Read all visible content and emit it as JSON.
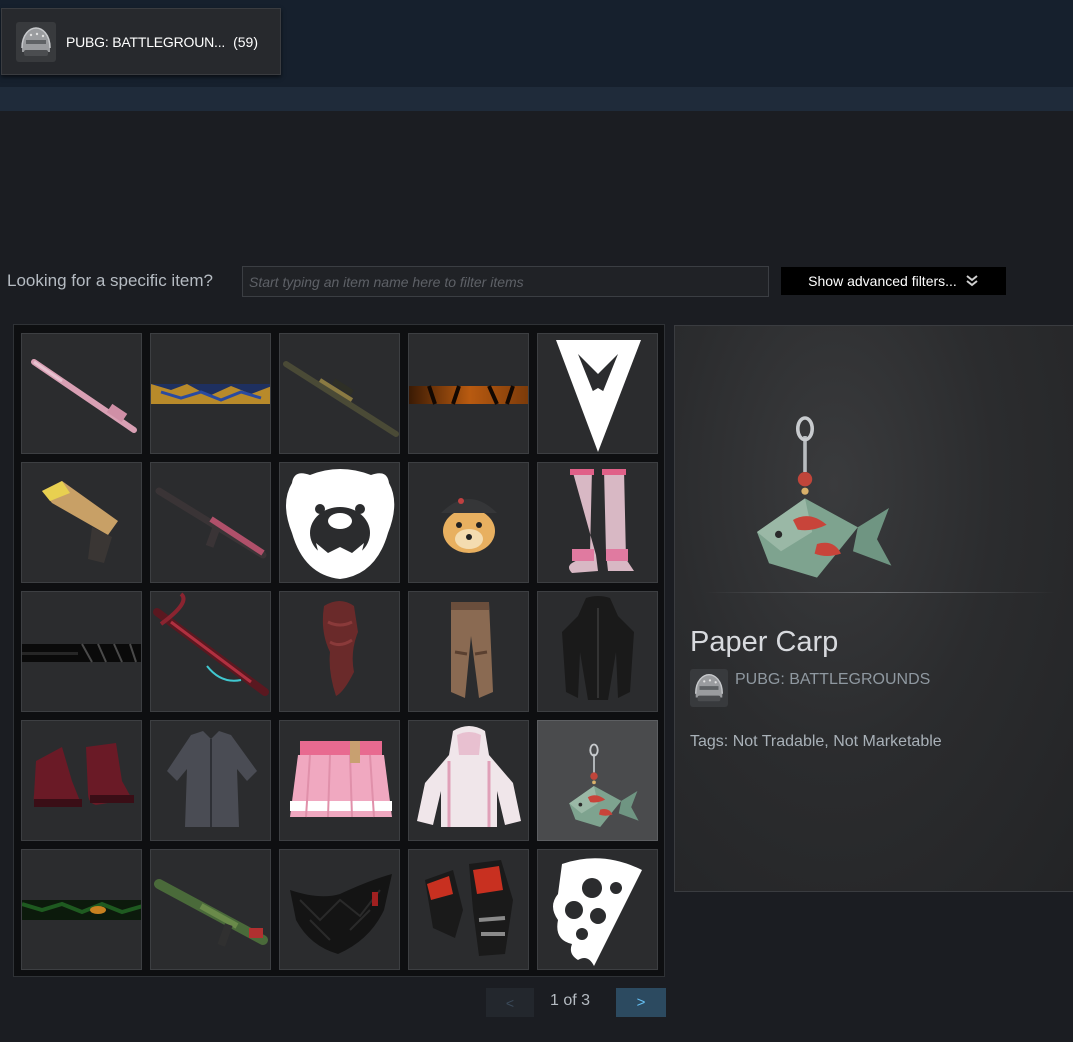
{
  "game_tab": {
    "name": "PUBG: BATTLEGROUN...",
    "count": "(59)",
    "icon": "helmet-icon"
  },
  "filter": {
    "label": "Looking for a specific item?",
    "placeholder": "Start typing an item name here to filter items",
    "advanced_label": "Show advanced filters..."
  },
  "items": [
    {
      "name": "pink-rifle",
      "icon": "rifle-icon"
    },
    {
      "name": "blue-gold-banner",
      "icon": "banner-icon"
    },
    {
      "name": "camo-sniper",
      "icon": "sniper-icon"
    },
    {
      "name": "tiger-banner",
      "icon": "banner-icon"
    },
    {
      "name": "arrow-emblem",
      "icon": "emblem-icon"
    },
    {
      "name": "desert-eagle",
      "icon": "pistol-icon"
    },
    {
      "name": "pink-assault-rifle",
      "icon": "rifle-icon"
    },
    {
      "name": "bear-emblem",
      "icon": "bear-icon"
    },
    {
      "name": "doge-emote",
      "icon": "dog-icon"
    },
    {
      "name": "pink-stockings",
      "icon": "legwear-icon"
    },
    {
      "name": "dark-banner",
      "icon": "banner-icon"
    },
    {
      "name": "crossbow",
      "icon": "crossbow-icon"
    },
    {
      "name": "red-scarf",
      "icon": "scarf-icon"
    },
    {
      "name": "brown-pants",
      "icon": "pants-icon"
    },
    {
      "name": "black-trenchcoat",
      "icon": "coat-icon"
    },
    {
      "name": "red-sneakers",
      "icon": "shoes-icon"
    },
    {
      "name": "grey-shirt",
      "icon": "shirt-icon"
    },
    {
      "name": "pink-skirt",
      "icon": "skirt-icon"
    },
    {
      "name": "pink-hoodie",
      "icon": "hoodie-icon"
    },
    {
      "name": "paper-carp-charm",
      "icon": "fish-charm-icon",
      "selected": true
    },
    {
      "name": "green-banner",
      "icon": "banner-icon"
    },
    {
      "name": "green-launcher",
      "icon": "launcher-icon"
    },
    {
      "name": "black-mask",
      "icon": "mask-icon"
    },
    {
      "name": "red-gloves",
      "icon": "gloves-icon"
    },
    {
      "name": "pizza-emblem",
      "icon": "pizza-icon"
    }
  ],
  "pager": {
    "prev": "<",
    "text": "1 of 3",
    "next": ">"
  },
  "detail": {
    "name": "Paper Carp",
    "game": "PUBG: BATTLEGROUNDS",
    "tags": "Tags: Not Tradable, Not Marketable"
  },
  "colors": {
    "accent": "#66c0f4",
    "background": "#1b1d22",
    "topbar": "#16202d"
  }
}
